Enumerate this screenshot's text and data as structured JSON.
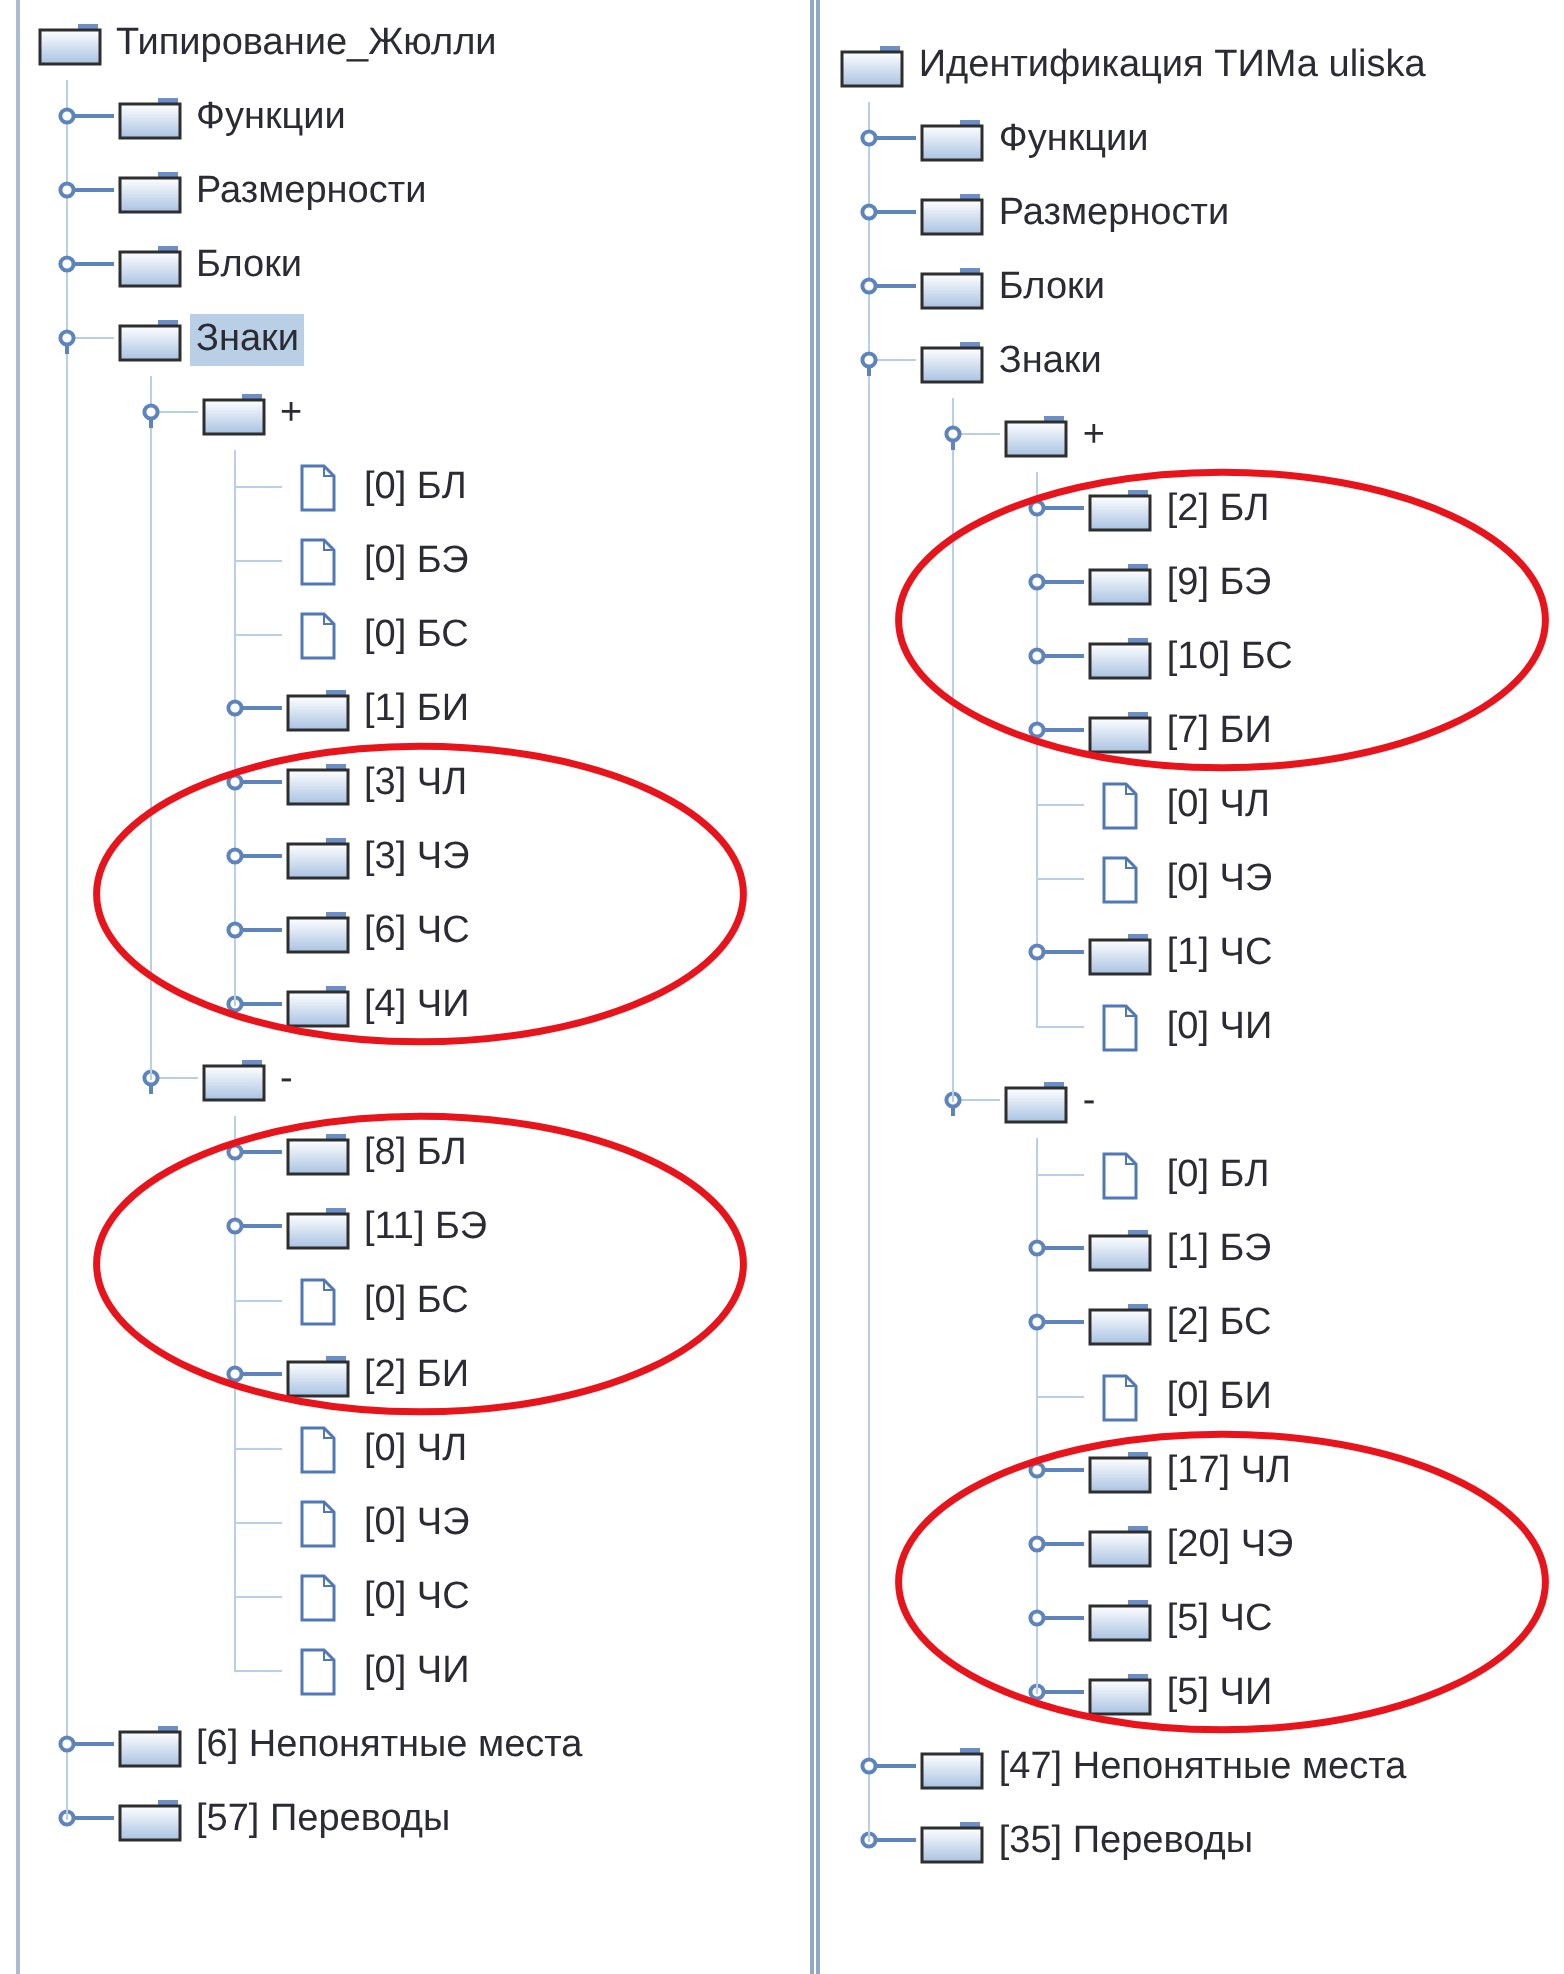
{
  "panels": [
    {
      "tree": {
        "label": "Типирование_Жюлли",
        "kind": "folder",
        "selected": false,
        "children": [
          {
            "label": "Функции",
            "kind": "folder",
            "expanded": false,
            "selected": false
          },
          {
            "label": "Размерности",
            "kind": "folder",
            "expanded": false,
            "selected": false
          },
          {
            "label": "Блоки",
            "kind": "folder",
            "expanded": false,
            "selected": false
          },
          {
            "label": "Знаки",
            "kind": "folder",
            "expanded": true,
            "selected": true,
            "children": [
              {
                "label": "+",
                "kind": "folder",
                "expanded": true,
                "selected": false,
                "children": [
                  {
                    "label": "[0] БЛ",
                    "kind": "leaf",
                    "selected": false,
                    "circled": false
                  },
                  {
                    "label": "[0] БЭ",
                    "kind": "leaf",
                    "selected": false,
                    "circled": false
                  },
                  {
                    "label": "[0] БС",
                    "kind": "leaf",
                    "selected": false,
                    "circled": false
                  },
                  {
                    "label": "[1] БИ",
                    "kind": "folder",
                    "expanded": false,
                    "selected": false,
                    "circled": false
                  },
                  {
                    "label": "[3] ЧЛ",
                    "kind": "folder",
                    "expanded": false,
                    "selected": false,
                    "circled": true
                  },
                  {
                    "label": "[3] ЧЭ",
                    "kind": "folder",
                    "expanded": false,
                    "selected": false,
                    "circled": true
                  },
                  {
                    "label": "[6] ЧС",
                    "kind": "folder",
                    "expanded": false,
                    "selected": false,
                    "circled": true
                  },
                  {
                    "label": "[4] ЧИ",
                    "kind": "folder",
                    "expanded": false,
                    "selected": false,
                    "circled": true
                  }
                ]
              },
              {
                "label": "-",
                "kind": "folder",
                "expanded": true,
                "selected": false,
                "children": [
                  {
                    "label": "[8] БЛ",
                    "kind": "folder",
                    "expanded": false,
                    "selected": false,
                    "circled": true
                  },
                  {
                    "label": "[11] БЭ",
                    "kind": "folder",
                    "expanded": false,
                    "selected": false,
                    "circled": true
                  },
                  {
                    "label": "[0] БС",
                    "kind": "leaf",
                    "selected": false,
                    "circled": true
                  },
                  {
                    "label": "[2] БИ",
                    "kind": "folder",
                    "expanded": false,
                    "selected": false,
                    "circled": true
                  },
                  {
                    "label": "[0] ЧЛ",
                    "kind": "leaf",
                    "selected": false,
                    "circled": false
                  },
                  {
                    "label": "[0] ЧЭ",
                    "kind": "leaf",
                    "selected": false,
                    "circled": false
                  },
                  {
                    "label": "[0] ЧС",
                    "kind": "leaf",
                    "selected": false,
                    "circled": false
                  },
                  {
                    "label": "[0] ЧИ",
                    "kind": "leaf",
                    "selected": false,
                    "circled": false
                  }
                ]
              }
            ]
          },
          {
            "label": "[6] Непонятные места",
            "kind": "folder",
            "expanded": false,
            "selected": false
          },
          {
            "label": "[57] Переводы",
            "kind": "folder",
            "expanded": false,
            "selected": false
          }
        ]
      }
    },
    {
      "tree": {
        "label": "Идентификация ТИМа uliska",
        "kind": "folder",
        "selected": false,
        "children": [
          {
            "label": "Функции",
            "kind": "folder",
            "expanded": false,
            "selected": false
          },
          {
            "label": "Размерности",
            "kind": "folder",
            "expanded": false,
            "selected": false
          },
          {
            "label": "Блоки",
            "kind": "folder",
            "expanded": false,
            "selected": false
          },
          {
            "label": "Знаки",
            "kind": "folder",
            "expanded": true,
            "selected": false,
            "children": [
              {
                "label": "+",
                "kind": "folder",
                "expanded": true,
                "selected": false,
                "children": [
                  {
                    "label": "[2] БЛ",
                    "kind": "folder",
                    "expanded": false,
                    "selected": false,
                    "circled": true
                  },
                  {
                    "label": "[9] БЭ",
                    "kind": "folder",
                    "expanded": false,
                    "selected": false,
                    "circled": true
                  },
                  {
                    "label": "[10] БС",
                    "kind": "folder",
                    "expanded": false,
                    "selected": false,
                    "circled": true
                  },
                  {
                    "label": "[7] БИ",
                    "kind": "folder",
                    "expanded": false,
                    "selected": false,
                    "circled": true
                  },
                  {
                    "label": "[0] ЧЛ",
                    "kind": "leaf",
                    "selected": false,
                    "circled": false
                  },
                  {
                    "label": "[0] ЧЭ",
                    "kind": "leaf",
                    "selected": false,
                    "circled": false
                  },
                  {
                    "label": "[1] ЧС",
                    "kind": "folder",
                    "expanded": false,
                    "selected": false,
                    "circled": false
                  },
                  {
                    "label": "[0] ЧИ",
                    "kind": "leaf",
                    "selected": false,
                    "circled": false
                  }
                ]
              },
              {
                "label": "-",
                "kind": "folder",
                "expanded": true,
                "selected": false,
                "children": [
                  {
                    "label": "[0] БЛ",
                    "kind": "leaf",
                    "selected": false,
                    "circled": false
                  },
                  {
                    "label": "[1] БЭ",
                    "kind": "folder",
                    "expanded": false,
                    "selected": false,
                    "circled": false
                  },
                  {
                    "label": "[2] БС",
                    "kind": "folder",
                    "expanded": false,
                    "selected": false,
                    "circled": false
                  },
                  {
                    "label": "[0] БИ",
                    "kind": "leaf",
                    "selected": false,
                    "circled": false
                  },
                  {
                    "label": "[17] ЧЛ",
                    "kind": "folder",
                    "expanded": false,
                    "selected": false,
                    "circled": true
                  },
                  {
                    "label": "[20] ЧЭ",
                    "kind": "folder",
                    "expanded": false,
                    "selected": false,
                    "circled": true
                  },
                  {
                    "label": "[5] ЧС",
                    "kind": "folder",
                    "expanded": false,
                    "selected": false,
                    "circled": true
                  },
                  {
                    "label": "[5] ЧИ",
                    "kind": "folder",
                    "expanded": false,
                    "selected": false,
                    "circled": true
                  }
                ]
              }
            ]
          },
          {
            "label": "[47] Непонятные места",
            "kind": "folder",
            "expanded": false,
            "selected": false
          },
          {
            "label": "[35] Переводы",
            "kind": "folder",
            "expanded": false,
            "selected": false
          }
        ]
      }
    }
  ]
}
